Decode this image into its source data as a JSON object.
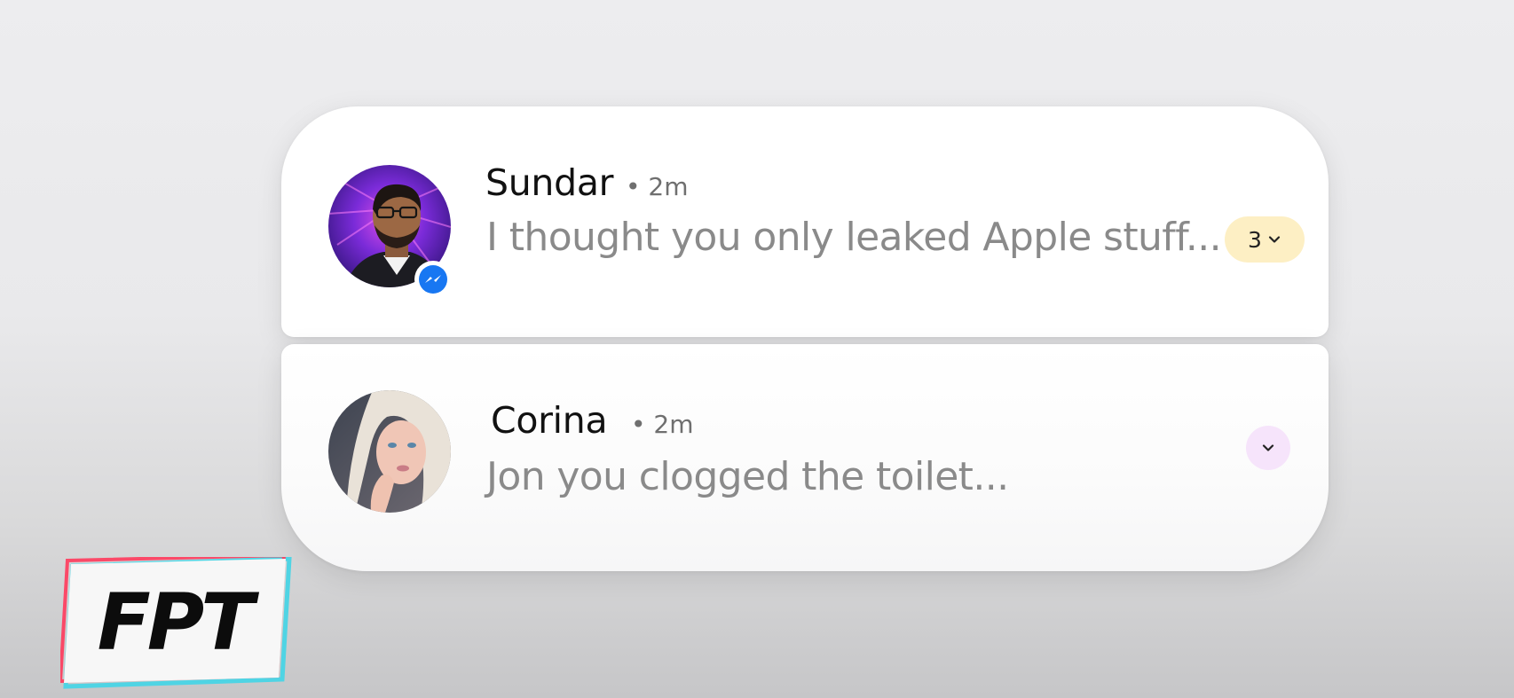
{
  "notifications": [
    {
      "sender": "Sundar",
      "time": "• 2m",
      "message": "I thought you only leaked Apple stuff...",
      "count": "3",
      "app_icon": "messenger-icon",
      "avatar": "sundar-avatar"
    },
    {
      "sender": "Corina",
      "time": "• 2m",
      "message": "Jon you clogged the toilet...",
      "avatar": "corina-avatar"
    }
  ],
  "logo": {
    "text": "FPT"
  },
  "colors": {
    "count_pill": "#fdefc4",
    "expand_circle": "#f6e4fb",
    "messenger_blue": "#1877f2",
    "message_text": "#8a8a8a"
  }
}
